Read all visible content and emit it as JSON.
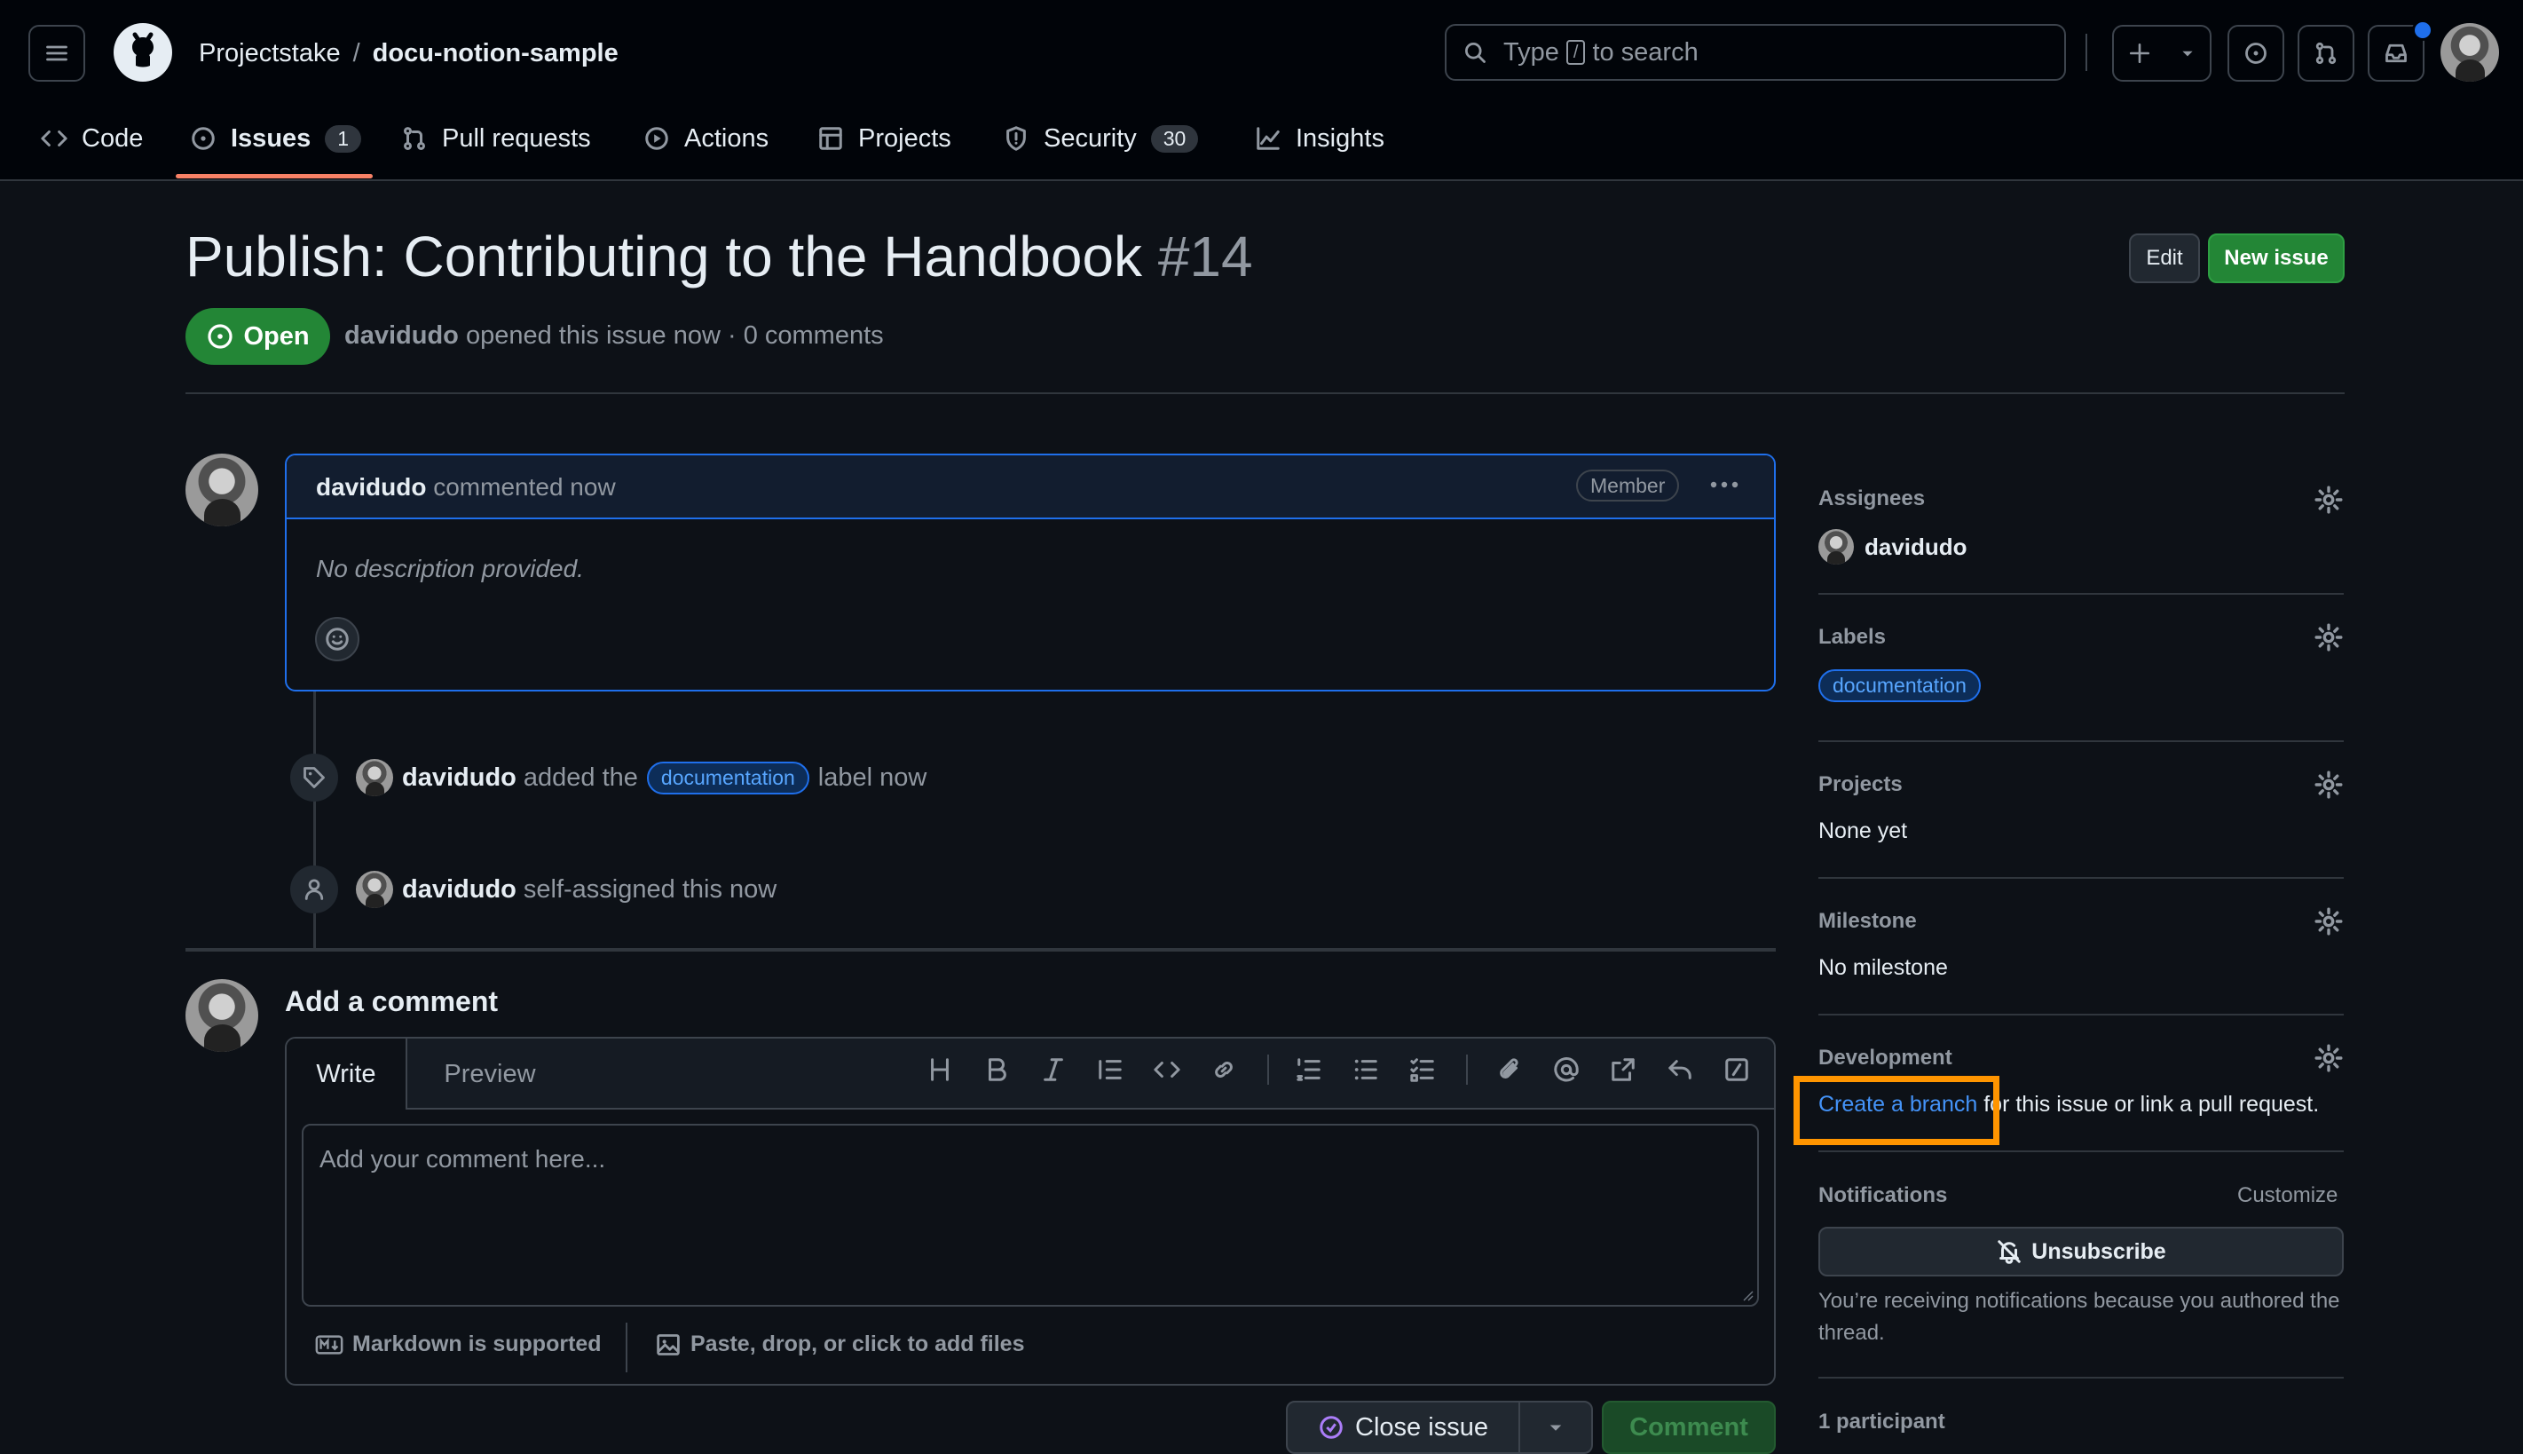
{
  "header": {
    "owner": "Projectstake",
    "separator": "/",
    "repo": "docu-notion-sample",
    "search_before": "Type",
    "search_key": "/",
    "search_after": "to search"
  },
  "tabs": [
    {
      "label": "Code",
      "icon": "code-icon"
    },
    {
      "label": "Issues",
      "icon": "issue-opened-icon",
      "count": "1",
      "selected": true
    },
    {
      "label": "Pull requests",
      "icon": "git-pull-request-icon"
    },
    {
      "label": "Actions",
      "icon": "play-icon"
    },
    {
      "label": "Projects",
      "icon": "table-icon"
    },
    {
      "label": "Security",
      "icon": "shield-icon",
      "count": "30"
    },
    {
      "label": "Insights",
      "icon": "graph-icon"
    }
  ],
  "issue": {
    "title": "Publish: Contributing to the Handbook",
    "number": "#14",
    "state": "Open",
    "author": "davidudo",
    "meta": "opened this issue now · 0 comments",
    "edit_label": "Edit",
    "new_issue_label": "New issue"
  },
  "comment": {
    "author": "davidudo",
    "time": "commented now",
    "badge": "Member",
    "body": "No description provided."
  },
  "timeline": [
    {
      "author": "davidudo",
      "text_before": "added the",
      "label": "documentation",
      "text_after": "label now",
      "icon": "tag-icon"
    },
    {
      "author": "davidudo",
      "text": "self-assigned this now",
      "icon": "person-icon"
    }
  ],
  "composer": {
    "heading": "Add a comment",
    "tab_write": "Write",
    "tab_preview": "Preview",
    "placeholder": "Add your comment here...",
    "markdown_note": "Markdown is supported",
    "files_note": "Paste, drop, or click to add files",
    "close_issue": "Close issue",
    "comment_button": "Comment"
  },
  "sidebar": {
    "assignees_h": "Assignees",
    "assignee": "davidudo",
    "labels_h": "Labels",
    "label": "documentation",
    "projects_h": "Projects",
    "projects_v": "None yet",
    "milestone_h": "Milestone",
    "milestone_v": "No milestone",
    "development_h": "Development",
    "create_branch": "Create a branch",
    "development_rest": "for this issue or link a pull request.",
    "notifications_h": "Notifications",
    "customize": "Customize",
    "unsubscribe": "Unsubscribe",
    "notif_reason": "You’re receiving notifications because you authored the thread.",
    "participants": "1 participant"
  },
  "colors": {
    "accent_open": "#238636",
    "link": "#4493f8",
    "highlight": "#ff9500",
    "tab_underline": "#f78166",
    "notification_dot": "#1f6feb"
  }
}
